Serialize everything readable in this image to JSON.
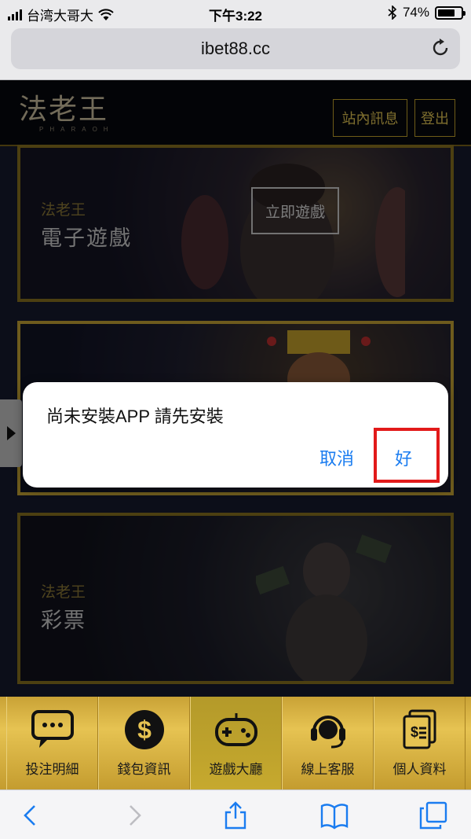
{
  "status_bar": {
    "carrier": "台湾大哥大",
    "time": "下午3:22",
    "battery_text": "74%",
    "battery_level": 0.74
  },
  "browser": {
    "url": "ibet88.cc"
  },
  "site_header": {
    "logo_text": "法老王",
    "logo_subtext": "PHARAOH",
    "messages_label": "站內訊息",
    "logout_label": "登出"
  },
  "cards": [
    {
      "subtitle": "法老王",
      "title": "電子遊戲",
      "button": "立即遊戲"
    },
    {
      "subtitle": "",
      "title": ""
    },
    {
      "subtitle": "法老王",
      "title": "彩票"
    }
  ],
  "bottom_nav": {
    "items": [
      {
        "label": "投注明細",
        "icon": "chat-icon"
      },
      {
        "label": "錢包資訊",
        "icon": "dollar-coin-icon"
      },
      {
        "label": "遊戲大廳",
        "icon": "gamepad-icon",
        "active": true
      },
      {
        "label": "線上客服",
        "icon": "headset-icon"
      },
      {
        "label": "個人資料",
        "icon": "document-icon"
      }
    ]
  },
  "alert": {
    "message": "尚未安裝APP 請先安裝",
    "cancel_label": "取消",
    "ok_label": "好"
  },
  "colors": {
    "accent_gold": "#c8a736",
    "ios_blue": "#1a7cf0",
    "highlight_red": "#e21a1a"
  }
}
